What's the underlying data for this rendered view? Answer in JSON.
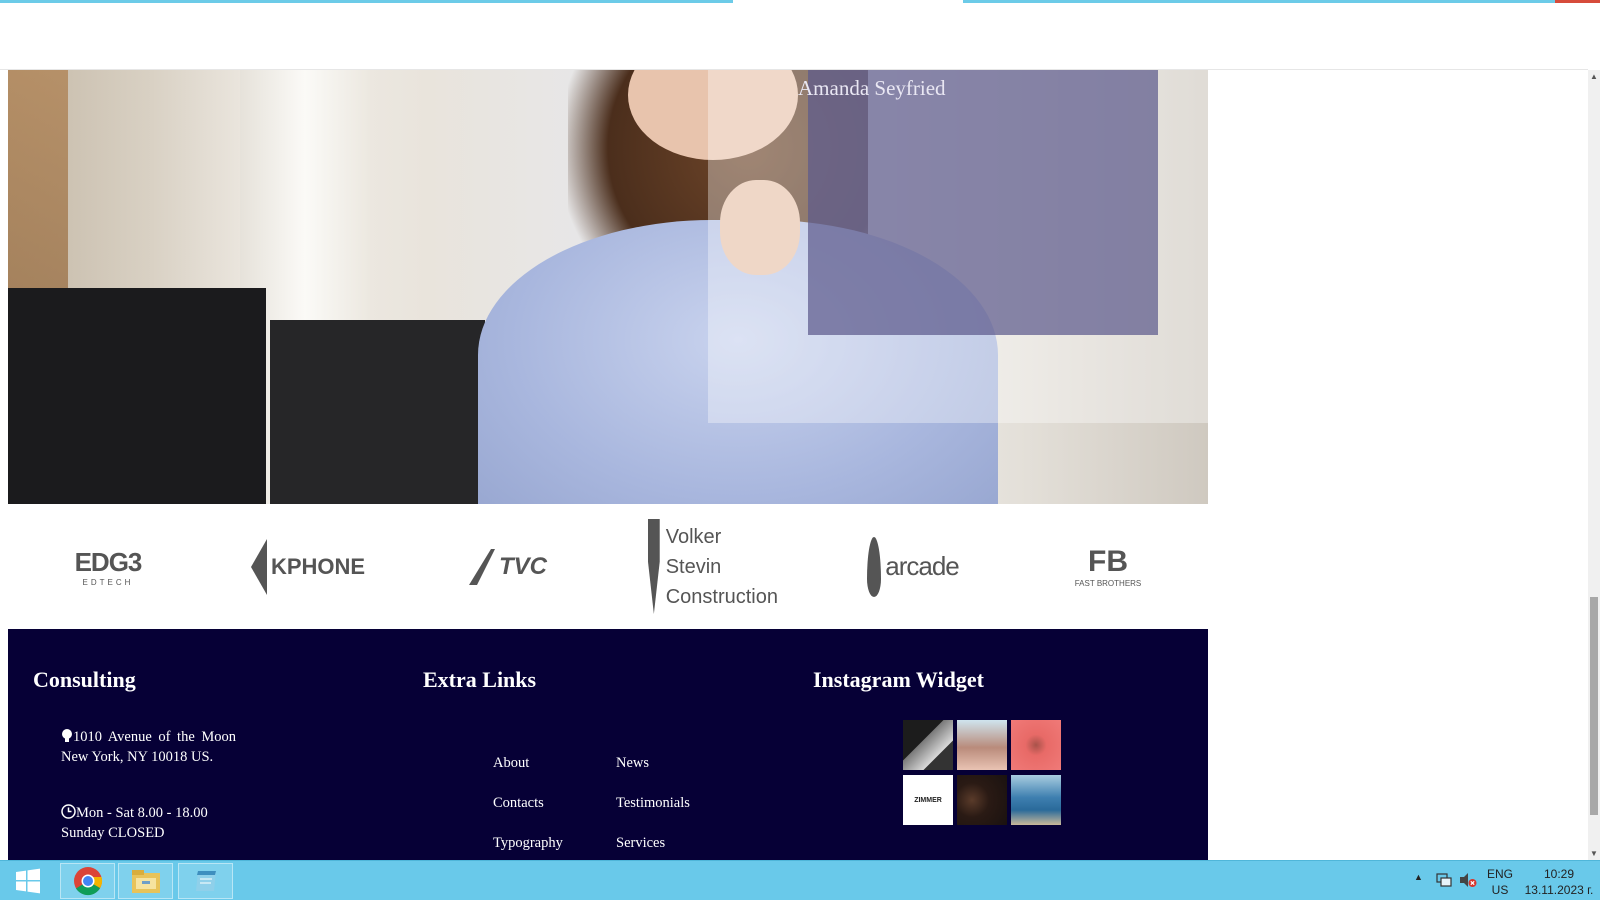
{
  "hero": {
    "person_name": "Amanda Seyfried"
  },
  "logos": [
    {
      "name": "EDG3",
      "sub": "EDTECH"
    },
    {
      "name": "KPHONE"
    },
    {
      "name": "TVC"
    },
    {
      "name_line1": "Volker Stevin",
      "name_line2": "Construction"
    },
    {
      "name": "arcade"
    },
    {
      "name": "FB",
      "sub": "FAST BROTHERS"
    }
  ],
  "footer": {
    "consulting": {
      "title": "Consulting",
      "address": "1010 Avenue of the Moon New York, NY 10018 US.",
      "hours": "Mon - Sat 8.00 - 18.00 Sunday CLOSED"
    },
    "extra_links": {
      "title": "Extra Links",
      "col1": [
        "About",
        "Contacts",
        "Typography"
      ],
      "col2": [
        "News",
        "Testimonials",
        "Services"
      ]
    },
    "instagram": {
      "title": "Instagram Widget",
      "thumb_label": "ZIMMER"
    }
  },
  "taskbar": {
    "lang_line1": "ENG",
    "lang_line2": "US",
    "time": "10:29",
    "date": "13.11.2023 г."
  },
  "colors": {
    "footer_bg": "#060036",
    "taskbar_bg": "#69c9ea",
    "overlay_card": "#5d5a8c"
  },
  "icons": [
    "bulb-icon",
    "clock-icon",
    "windows-start-icon",
    "chrome-icon",
    "file-explorer-icon",
    "notepad-icon",
    "network-icon",
    "volume-muted-icon",
    "tray-up-arrow-icon"
  ]
}
